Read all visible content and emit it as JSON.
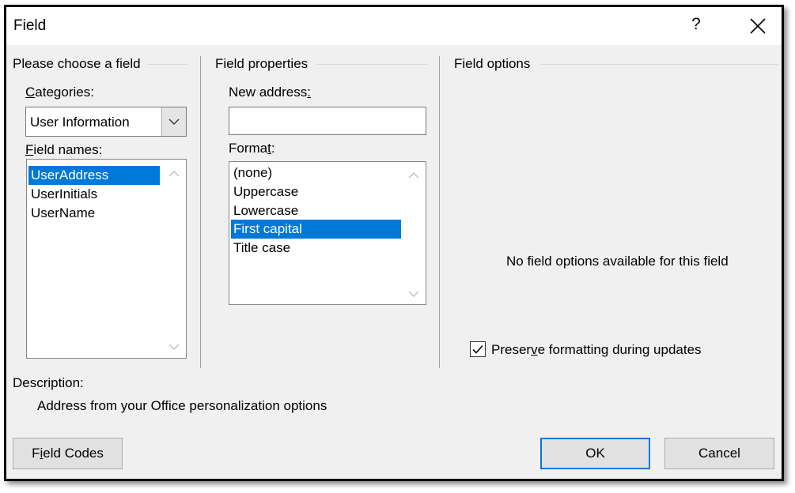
{
  "window": {
    "title": "Field",
    "help_label": "?",
    "close_icon": "close-icon"
  },
  "choose_field": {
    "section_title": "Please choose a field",
    "categories_label": "Categories:",
    "categories_value": "User Information",
    "field_names_label": "Field names:",
    "field_names": [
      "UserAddress",
      "UserInitials",
      "UserName"
    ],
    "selected_field": "UserAddress"
  },
  "field_properties": {
    "section_title": "Field properties",
    "new_address_label": "New address:",
    "new_address_value": "",
    "format_label": "Format:",
    "formats": [
      "(none)",
      "Uppercase",
      "Lowercase",
      "First capital",
      "Title case"
    ],
    "selected_format": "First capital"
  },
  "field_options": {
    "section_title": "Field options",
    "message": "No field options available for this field",
    "preserve_label": "Preserve formatting during updates",
    "preserve_checked": true
  },
  "description": {
    "label": "Description:",
    "text": "Address from your Office personalization options"
  },
  "buttons": {
    "field_codes": "Field Codes",
    "ok": "OK",
    "cancel": "Cancel"
  },
  "colors": {
    "selection": "#0078d7",
    "dialog_bg": "#f0f0f0",
    "default_button_border": "#0078d7"
  }
}
